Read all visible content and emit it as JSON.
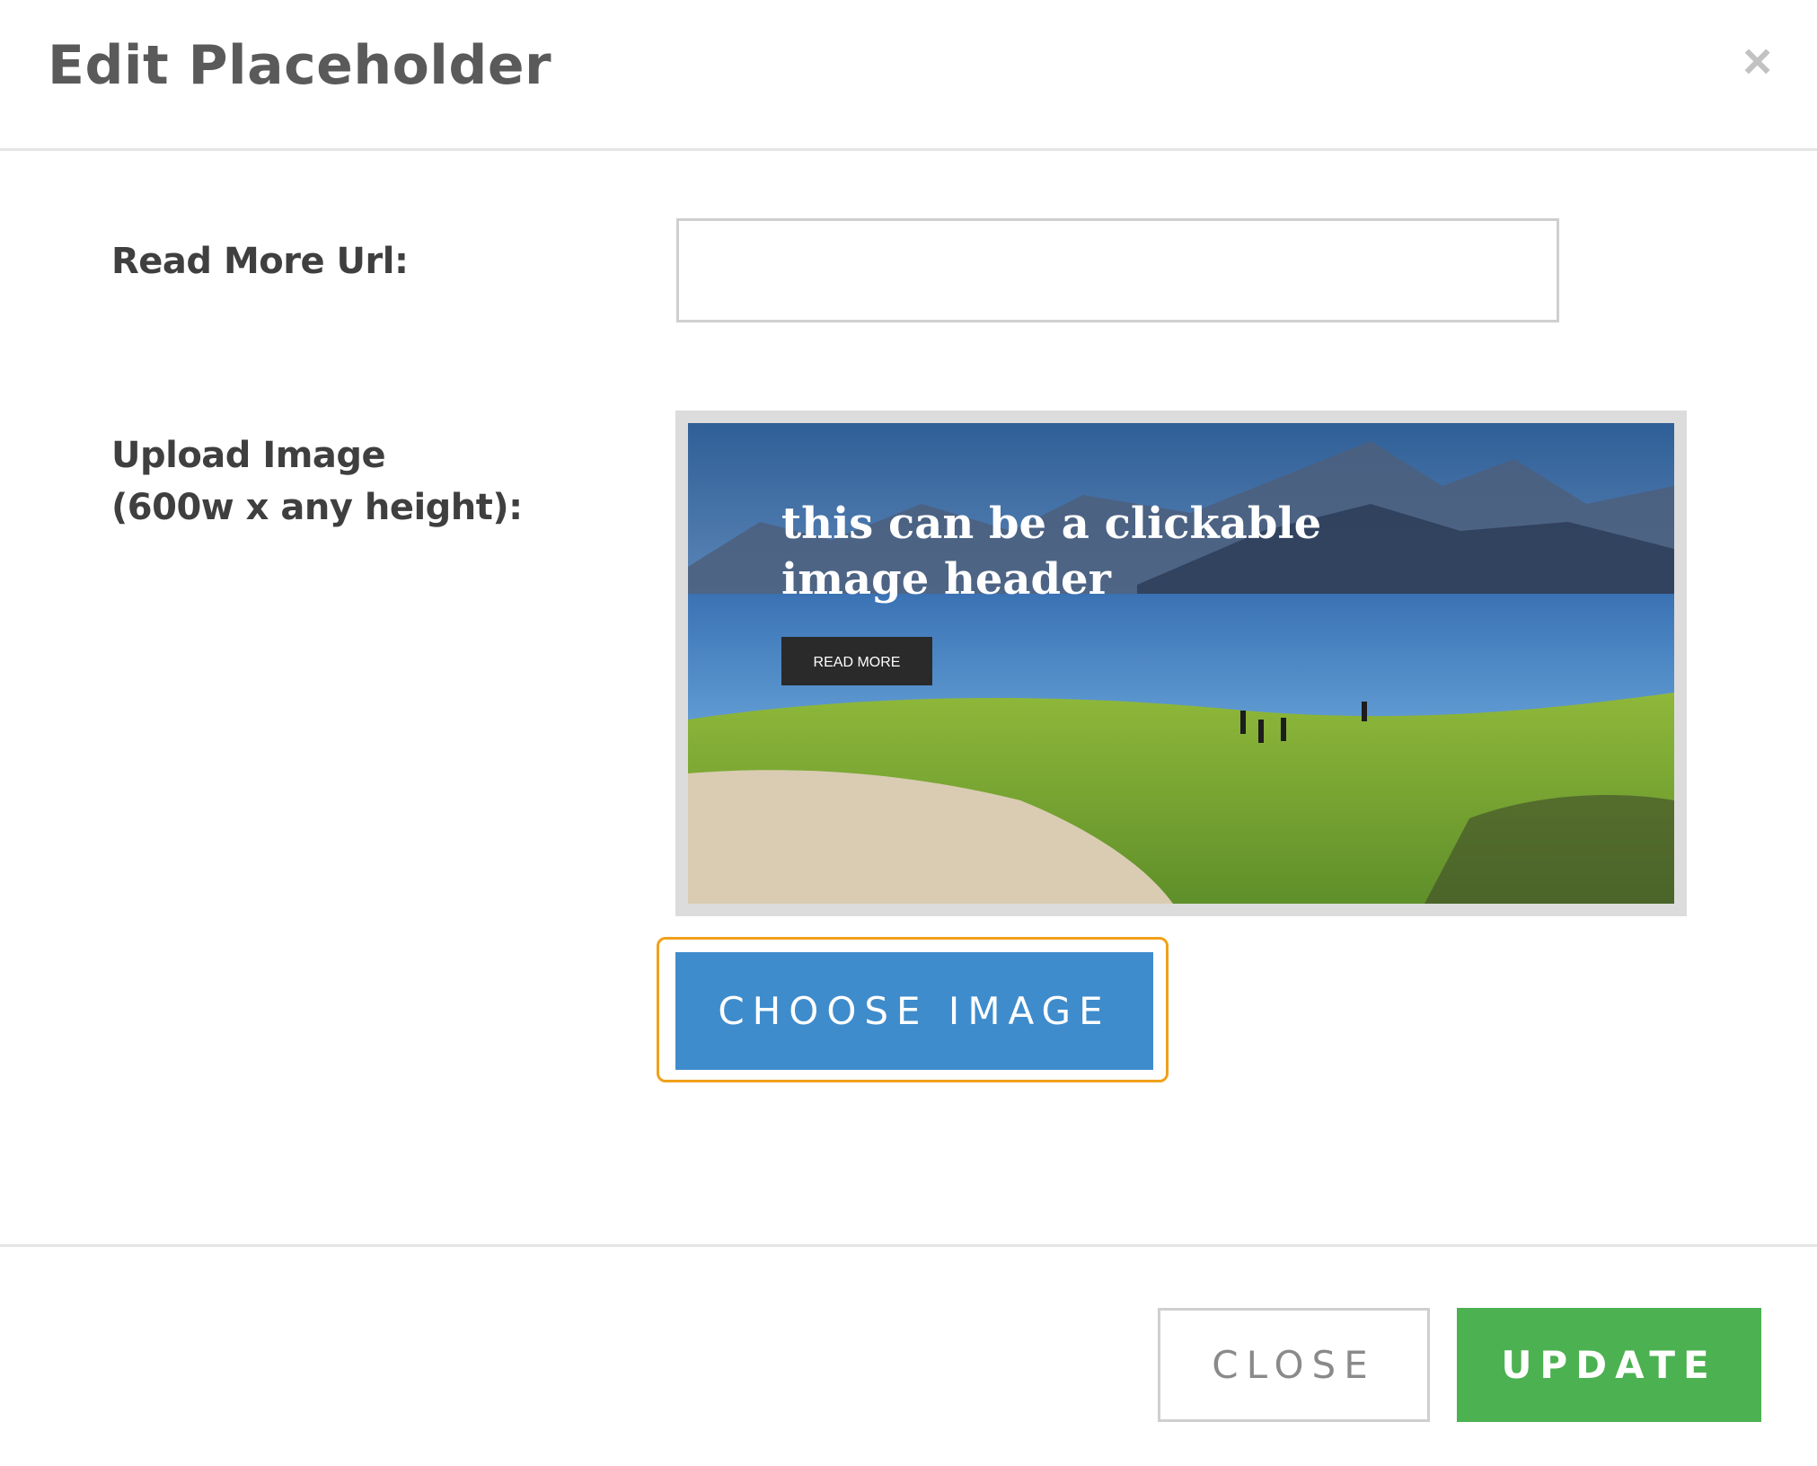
{
  "dialog": {
    "title": "Edit Placeholder",
    "close_icon_glyph": "×"
  },
  "form": {
    "read_more_url": {
      "label": "Read More Url:",
      "value": "",
      "placeholder": ""
    },
    "upload_image": {
      "label_line1": "Upload Image",
      "label_line2": "(600w x any height):",
      "preview": {
        "heading_line1": "this can be a clickable",
        "heading_line2": "image header",
        "button_label": "READ MORE"
      },
      "choose_button_label": "CHOOSE IMAGE"
    }
  },
  "footer": {
    "close_label": "CLOSE",
    "update_label": "UPDATE"
  },
  "colors": {
    "primary": "#3f8ccc",
    "success": "#4cb150",
    "focus_outline": "#f0a11a"
  },
  "icons": {
    "close": "close-icon"
  }
}
